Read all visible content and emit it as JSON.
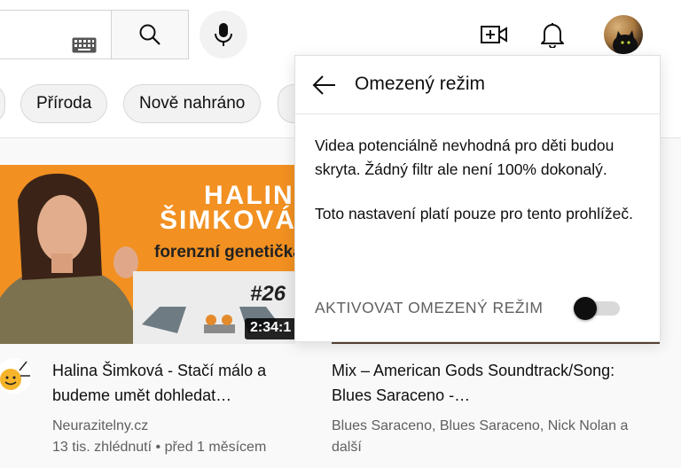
{
  "chips": [
    {
      "label": "Příroda"
    },
    {
      "label": "Nově nahráno"
    }
  ],
  "restricted_panel": {
    "title": "Omezený režim",
    "paragraph1": "Videa potenciálně nevhodná pro děti budou skryta. Žádný filtr ale není 100% dokonalý.",
    "paragraph2": "Toto nastavení platí pouze pro tento prohlížeč.",
    "toggle_label": "AKTIVOVAT OMEZENÝ REŽIM",
    "toggle_on": false
  },
  "videos": [
    {
      "title": "Halina Šimková - Stačí málo a budeme umět dohledat…",
      "channel": "Neurazitelny.cz",
      "stats": "13 tis. zhlédnutí • před 1 měsícem",
      "duration": "2:34:1",
      "thumb_text": {
        "name1": "HALINA",
        "name2": "ŠIMKOVÁ",
        "subtitle": "forenzní genetička",
        "episode": "#26"
      }
    },
    {
      "title": "Mix – American Gods Soundtrack/Song: Blues Saraceno -…",
      "channel": "Blues Saraceno, Blues Saraceno, Nick Nolan a další"
    }
  ],
  "icons": {
    "keyboard": "keyboard-icon",
    "search": "search-icon",
    "mic": "microphone-icon",
    "create": "video-create-icon",
    "bell": "bell-icon",
    "back": "arrow-back-icon"
  }
}
